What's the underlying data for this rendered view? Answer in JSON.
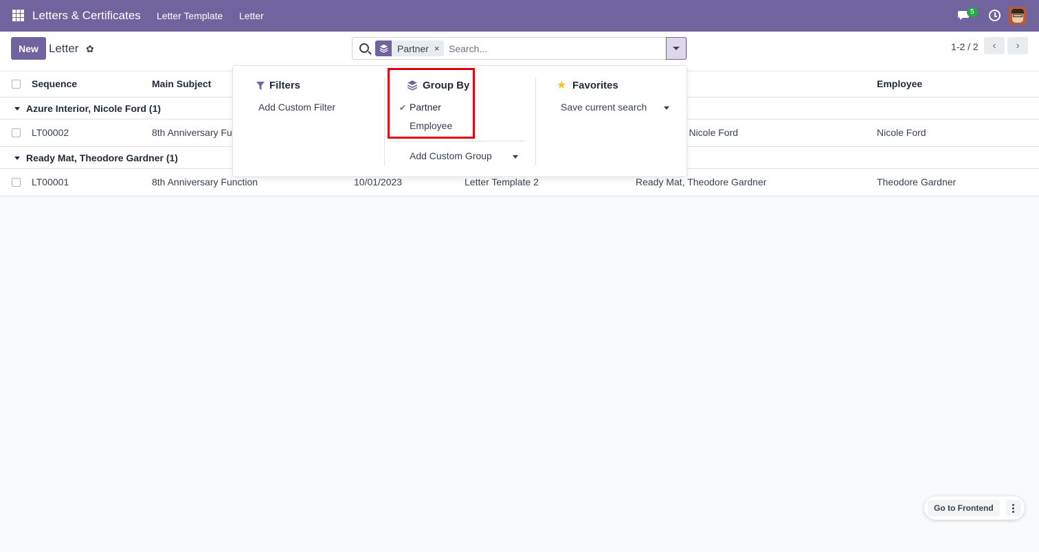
{
  "topbar": {
    "app_title": "Letters & Certificates",
    "nav": [
      "Letter Template",
      "Letter"
    ],
    "chat_badge": "5",
    "icons": [
      "apps-grid-icon",
      "chat-icon",
      "clock-icon",
      "avatar"
    ]
  },
  "control": {
    "new_label": "New",
    "title": "Letter",
    "search": {
      "facet_label": "Partner",
      "facet_remove": "×",
      "placeholder": "Search..."
    },
    "pager": {
      "value": "1-2 / 2",
      "prev": "‹",
      "next": "›"
    }
  },
  "list": {
    "columns": [
      "Sequence",
      "Main Subject",
      "Employee"
    ],
    "groups": [
      {
        "label": "Azure Interior, Nicole Ford (1)",
        "rows": [
          {
            "sequence": "LT00002",
            "subject": "8th Anniversary Fu",
            "partner": "or, Nicole Ford",
            "employee": "Nicole Ford"
          }
        ]
      },
      {
        "label": "Ready Mat, Theodore Gardner (1)",
        "rows": [
          {
            "sequence": "LT00001",
            "subject": "8th Anniversary Function",
            "date": "10/01/2023",
            "template": "Letter Template 2",
            "partner": "Ready Mat, Theodore Gardner",
            "employee": "Theodore Gardner"
          }
        ]
      }
    ]
  },
  "dropdown": {
    "filters": {
      "title": "Filters",
      "items": [
        "Add Custom Filter"
      ]
    },
    "group_by": {
      "title": "Group By",
      "items": [
        "Partner",
        "Employee"
      ],
      "checked": "Partner",
      "add_custom": "Add Custom Group"
    },
    "favorites": {
      "title": "Favorites",
      "items": [
        "Save current search"
      ]
    },
    "highlight_color": "#e3000f"
  },
  "floating": {
    "frontend_label": "Go to Frontend"
  },
  "colors": {
    "brand": "#71639e",
    "background": "#f9fafb"
  }
}
